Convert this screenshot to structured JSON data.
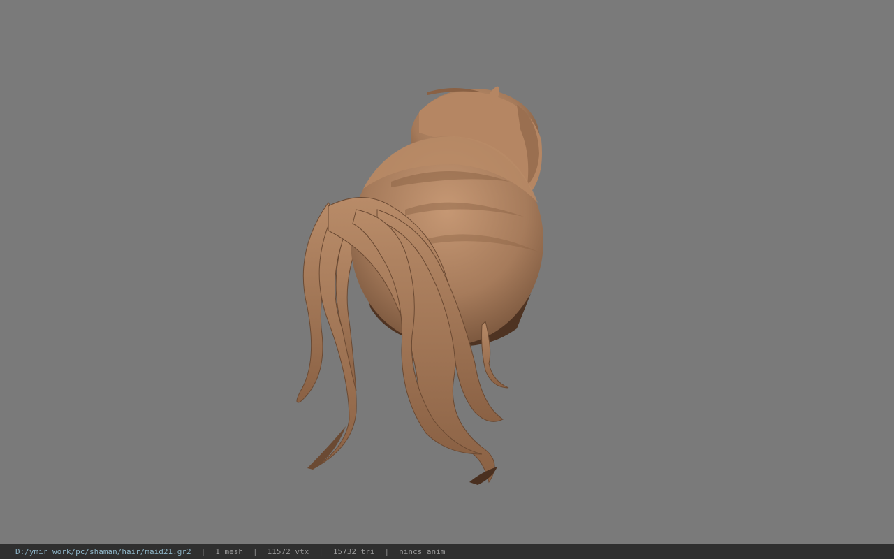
{
  "viewer": {
    "background_color": "#7a7a7a",
    "model": {
      "icon": "hair-mesh-render",
      "hair_color": "#a57a5a"
    }
  },
  "statusbar": {
    "file_path": "D:/ymir work/pc/shaman/hair/maid21.gr2",
    "separator": "|",
    "mesh_count": "1 mesh",
    "vertex_count": "11572 vtx",
    "triangle_count": "15732 tri",
    "anim_status": "nincs anim"
  }
}
